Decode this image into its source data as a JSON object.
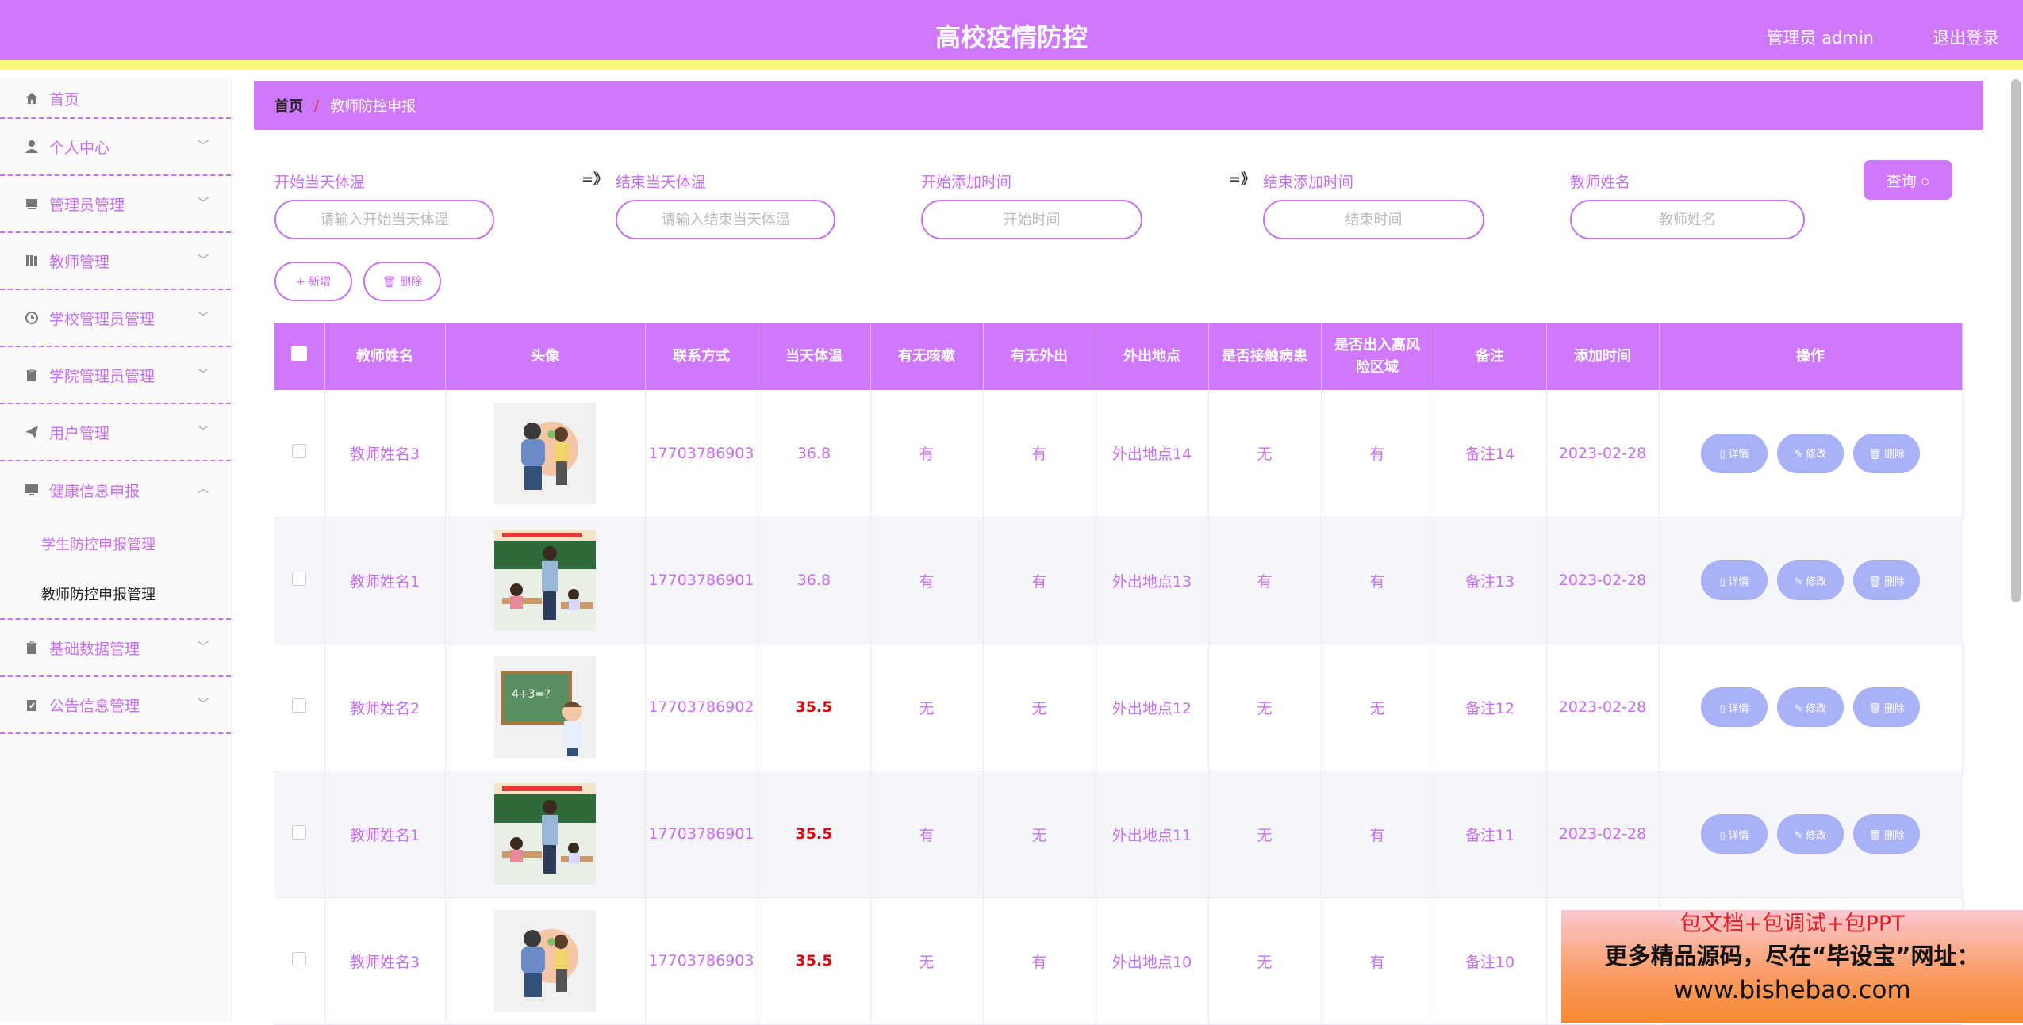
{
  "header": {
    "title": "高校疫情防控",
    "user": "管理员 admin",
    "logout": "退出登录"
  },
  "sidebar": {
    "items": [
      {
        "label": "首页",
        "icon": "home-icon"
      },
      {
        "label": "个人中心",
        "icon": "user-icon"
      },
      {
        "label": "管理员管理",
        "icon": "admin-icon"
      },
      {
        "label": "教师管理",
        "icon": "book-icon"
      },
      {
        "label": "学校管理员管理",
        "icon": "clock-icon"
      },
      {
        "label": "学院管理员管理",
        "icon": "clipboard-icon"
      },
      {
        "label": "用户管理",
        "icon": "send-icon"
      },
      {
        "label": "健康信息申报",
        "icon": "monitor-icon"
      },
      {
        "label": "基础数据管理",
        "icon": "clipboard-icon"
      },
      {
        "label": "公告信息管理",
        "icon": "clipboard-check-icon"
      }
    ],
    "sub_items": [
      "学生防控申报管理",
      "教师防控申报管理"
    ]
  },
  "breadcrumb": {
    "home": "首页",
    "sep": "/",
    "current": "教师防控申报"
  },
  "filters": {
    "start_temp_label": "开始当天体温",
    "start_temp_placeholder": "请输入开始当天体温",
    "end_temp_label": "结束当天体温",
    "end_temp_placeholder": "请输入结束当天体温",
    "start_time_label": "开始添加时间",
    "start_time_placeholder": "开始时间",
    "end_time_label": "结束添加时间",
    "end_time_placeholder": "结束时间",
    "name_label": "教师姓名",
    "name_placeholder": "教师姓名",
    "arrow": "=》",
    "query": "查询 ○"
  },
  "actions": {
    "add": "+ 新增",
    "delete": "🗑 删除"
  },
  "table": {
    "headers": [
      "教师姓名",
      "头像",
      "联系方式",
      "当天体温",
      "有无咳嗽",
      "有无外出",
      "外出地点",
      "是否接触病患",
      "是否出入高风险区域",
      "备注",
      "添加时间",
      "操作"
    ],
    "rows": [
      {
        "name": "教师姓名3",
        "phone": "17703786903",
        "temp": "36.8",
        "cough": "有",
        "out": "有",
        "place": "外出地点14",
        "contact": "无",
        "risk": "有",
        "note": "备注14",
        "time": "2023-02-28"
      },
      {
        "name": "教师姓名1",
        "phone": "17703786901",
        "temp": "36.8",
        "cough": "有",
        "out": "有",
        "place": "外出地点13",
        "contact": "有",
        "risk": "有",
        "note": "备注13",
        "time": "2023-02-28"
      },
      {
        "name": "教师姓名2",
        "phone": "17703786902",
        "temp": "35.5",
        "cough": "无",
        "out": "无",
        "place": "外出地点12",
        "contact": "无",
        "risk": "无",
        "note": "备注12",
        "time": "2023-02-28"
      },
      {
        "name": "教师姓名1",
        "phone": "17703786901",
        "temp": "35.5",
        "cough": "有",
        "out": "无",
        "place": "外出地点11",
        "contact": "无",
        "risk": "有",
        "note": "备注11",
        "time": "2023-02-28"
      },
      {
        "name": "教师姓名3",
        "phone": "17703786903",
        "temp": "35.5",
        "cough": "无",
        "out": "有",
        "place": "外出地点10",
        "contact": "无",
        "risk": "有",
        "note": "备注10",
        "time": ""
      }
    ],
    "op_buttons": {
      "detail": "▯ 详情",
      "edit": "✎ 修改",
      "delete": "🗑 删除"
    }
  },
  "ad": {
    "line1": "包文档+包调试+包PPT",
    "line2": "更多精品源码，尽在“毕设宝”网址：",
    "line3": "www.bishebao.com"
  },
  "colors": {
    "primary": "#cf78fb",
    "accent_yellow": "#f8f87a",
    "op_button": "#a9b2f6",
    "low_temp": "#d01010"
  }
}
